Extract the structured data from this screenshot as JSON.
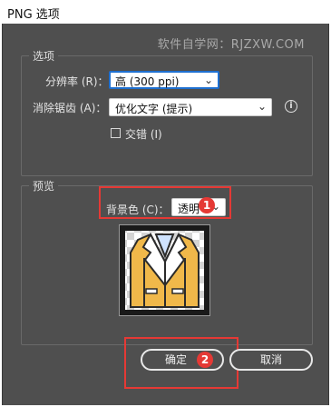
{
  "window": {
    "title": "PNG 选项"
  },
  "watermark": "软件自学网：RJZXW.COM",
  "options_group": {
    "title": "选项",
    "resolution": {
      "label": "分辨率 (R)：",
      "value": "高 (300 ppi)"
    },
    "antialias": {
      "label": "消除锯齿 (A)：",
      "value": "优化文字 (提示)"
    },
    "interlace": {
      "label": "交错 (I)",
      "checked": false
    }
  },
  "preview_group": {
    "title": "预览",
    "background": {
      "label": "背景色 (C)：",
      "value": "透明"
    }
  },
  "annotations": {
    "badge1": "1",
    "badge2": "2"
  },
  "buttons": {
    "ok": "确定",
    "cancel": "取消"
  },
  "colors": {
    "dialog_bg": "#4f4f4f",
    "annotation_red": "#e53935",
    "focus_blue": "#1e6fd0",
    "suit_gold": "#f0b84a"
  },
  "icons": {
    "info": "info-icon",
    "dropdown": "chevron-down-icon"
  }
}
